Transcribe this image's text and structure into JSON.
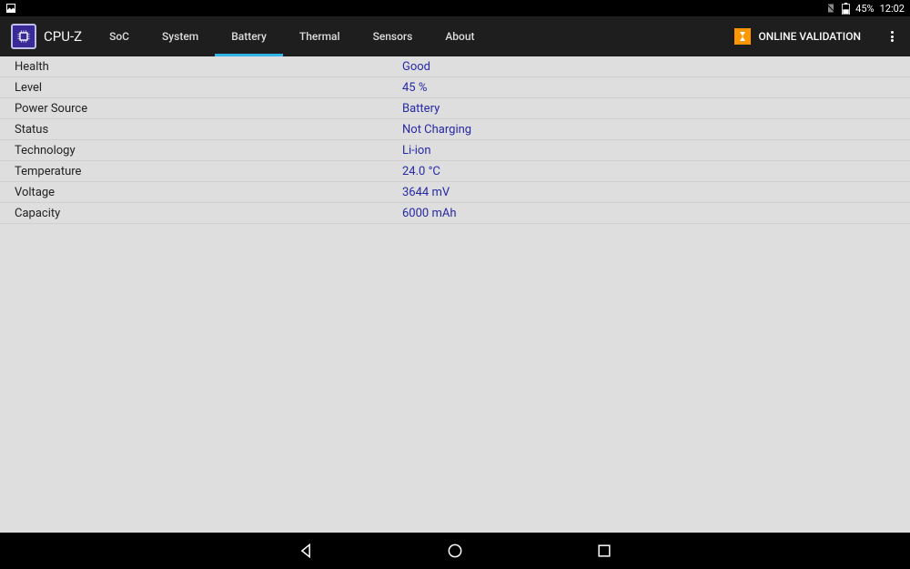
{
  "status_bar": {
    "battery_pct": "45%",
    "time": "12:02"
  },
  "app": {
    "title": "CPU-Z"
  },
  "tabs": [
    {
      "label": "SoC",
      "active": false
    },
    {
      "label": "System",
      "active": false
    },
    {
      "label": "Battery",
      "active": true
    },
    {
      "label": "Thermal",
      "active": false
    },
    {
      "label": "Sensors",
      "active": false
    },
    {
      "label": "About",
      "active": false
    }
  ],
  "actions": {
    "validation_label": "ONLINE VALIDATION"
  },
  "rows": [
    {
      "label": "Health",
      "value": "Good"
    },
    {
      "label": "Level",
      "value": "45 %"
    },
    {
      "label": "Power Source",
      "value": "Battery"
    },
    {
      "label": "Status",
      "value": "Not Charging"
    },
    {
      "label": "Technology",
      "value": "Li-ion"
    },
    {
      "label": "Temperature",
      "value": "24.0 °C"
    },
    {
      "label": "Voltage",
      "value": "3644 mV"
    },
    {
      "label": "Capacity",
      "value": "6000 mAh"
    }
  ]
}
